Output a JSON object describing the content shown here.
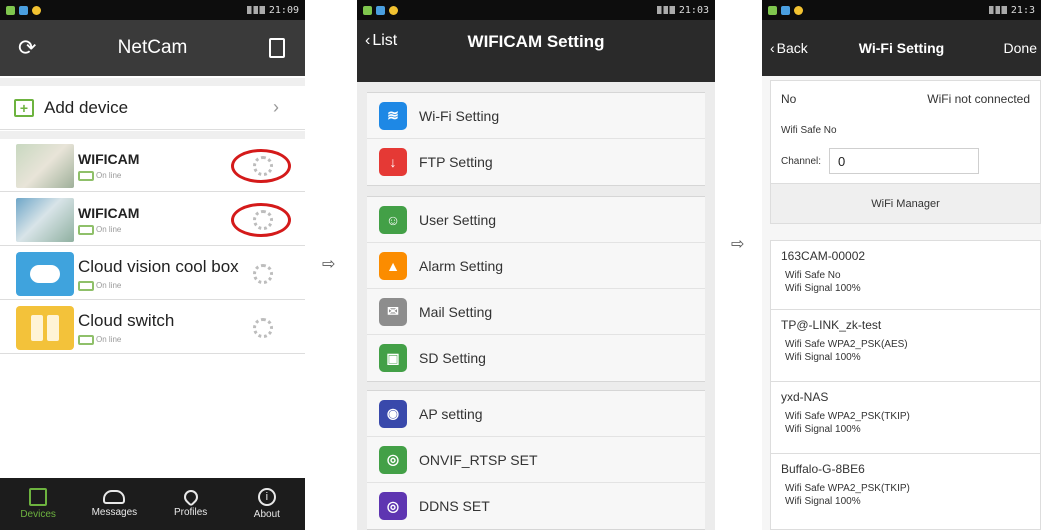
{
  "arrows": [
    "⇨",
    "⇨"
  ],
  "screen1": {
    "status_time": "21:09",
    "title": "NetCam",
    "add_device": "Add device",
    "devices": [
      {
        "name": "WIFICAM",
        "status": "On line",
        "highlighted": true
      },
      {
        "name": "WIFICAM",
        "status": "On line",
        "highlighted": true
      },
      {
        "name": "Cloud vision cool box",
        "status": "On line",
        "highlighted": false
      },
      {
        "name": "Cloud switch",
        "status": "On line",
        "highlighted": false
      }
    ],
    "tabs": [
      {
        "label": "Devices",
        "icon": "house-icon",
        "active": true
      },
      {
        "label": "Messages",
        "icon": "cloud-icon",
        "active": false
      },
      {
        "label": "Profiles",
        "icon": "heart-icon",
        "active": false
      },
      {
        "label": "About",
        "icon": "info-icon",
        "active": false
      }
    ],
    "colors": {
      "active_tab": "#6db33f",
      "highlight_ring": "#d41a1a"
    }
  },
  "screen2": {
    "status_time": "21:03",
    "back_label": "List",
    "title": "WIFICAM  Setting",
    "groups": [
      [
        {
          "label": "Wi-Fi Setting",
          "icon": "wifi-icon",
          "color": "#1e88e5"
        },
        {
          "label": "FTP Setting",
          "icon": "ftp-download-icon",
          "color": "#e53935"
        }
      ],
      [
        {
          "label": "User Setting",
          "icon": "user-icon",
          "color": "#43a047"
        },
        {
          "label": "Alarm Setting",
          "icon": "alarm-icon",
          "color": "#fb8c00"
        },
        {
          "label": "Mail Setting",
          "icon": "mail-icon",
          "color": "#8d8d8d"
        },
        {
          "label": "SD Setting",
          "icon": "sd-card-icon",
          "color": "#43a047"
        }
      ],
      [
        {
          "label": "AP setting",
          "icon": "ap-icon",
          "color": "#3949ab"
        },
        {
          "label": "ONVIF_RTSP SET",
          "icon": "onvif-icon",
          "color": "#43a047"
        },
        {
          "label": "DDNS SET",
          "icon": "ddns-icon",
          "color": "#5e35b1"
        }
      ]
    ]
  },
  "screen3": {
    "status_time": "21:3",
    "back_label": "Back",
    "title": "Wi-Fi Setting",
    "done_label": "Done",
    "current": {
      "label": "No",
      "value": "WiFi not connected"
    },
    "wifi_safe": "Wifi Safe  No",
    "channel_label": "Channel:",
    "channel_value": "0",
    "manager_button": "WiFi Manager",
    "networks": [
      {
        "name": "163CAM-00002",
        "safe": "Wifi Safe  No",
        "signal": "Wifi Signal  100%"
      },
      {
        "name": "TP@-LINK_zk-test",
        "safe": "Wifi Safe  WPA2_PSK(AES)",
        "signal": "Wifi Signal  100%"
      },
      {
        "name": "yxd-NAS",
        "safe": "Wifi Safe  WPA2_PSK(TKIP)",
        "signal": "Wifi Signal  100%"
      },
      {
        "name": "Buffalo-G-8BE6",
        "safe": "Wifi Safe  WPA2_PSK(TKIP)",
        "signal": "Wifi Signal  100%"
      }
    ]
  }
}
